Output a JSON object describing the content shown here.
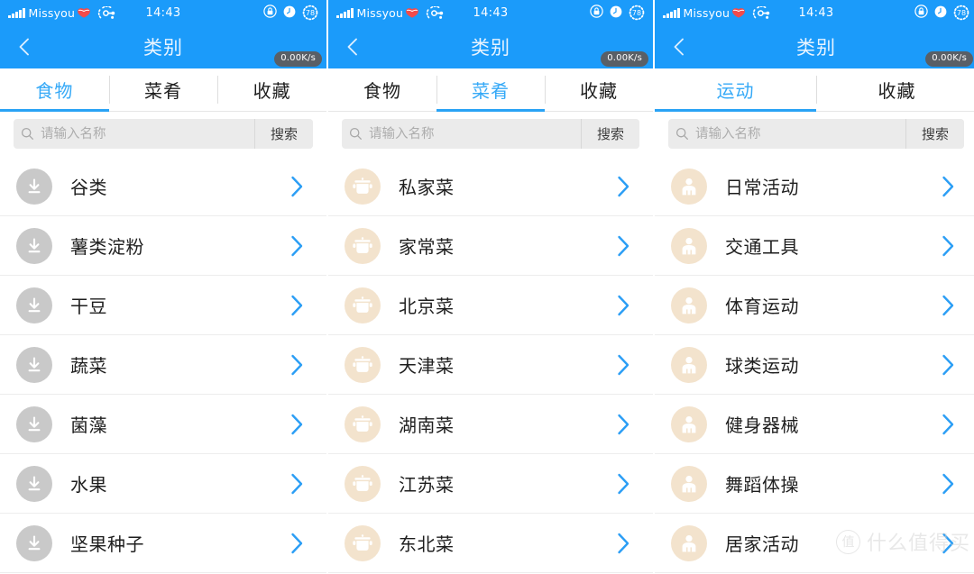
{
  "status_bar": {
    "carrier": "Missyou",
    "time": "14:43",
    "battery": "78",
    "icons": [
      "signal-bars-icon",
      "lips-icon",
      "network-ring-icon",
      "lock-icon",
      "alarm-icon",
      "battery-ring-icon"
    ]
  },
  "nav": {
    "title": "类别",
    "back_icon": "chevron-left-icon",
    "speed_badge": "0.00K/s"
  },
  "search": {
    "placeholder": "请输入名称",
    "value": "",
    "button_label": "搜索",
    "icon": "search-icon"
  },
  "colors": {
    "header_blue": "#1b9bfa",
    "tab_active_blue": "#35a9f7",
    "chevron_blue": "#2b9ef5",
    "icon_gray": "#c9c9c9",
    "icon_beige": "#f3e3cd",
    "search_bg": "#ebebeb",
    "badge_gray": "#595f66"
  },
  "watermark": {
    "mark": "值",
    "text": "什么值得买"
  },
  "panels": [
    {
      "id": "panel-food",
      "tabs": [
        {
          "label": "食物",
          "active": true
        },
        {
          "label": "菜肴",
          "active": false
        },
        {
          "label": "收藏",
          "active": false
        }
      ],
      "icon_style": "gray",
      "row_icon": "download-icon",
      "items": [
        {
          "label": "谷类"
        },
        {
          "label": "薯类淀粉"
        },
        {
          "label": "干豆"
        },
        {
          "label": "蔬菜"
        },
        {
          "label": "菌藻"
        },
        {
          "label": "水果"
        },
        {
          "label": "坚果种子"
        }
      ]
    },
    {
      "id": "panel-dishes",
      "tabs": [
        {
          "label": "食物",
          "active": false
        },
        {
          "label": "菜肴",
          "active": true
        },
        {
          "label": "收藏",
          "active": false
        }
      ],
      "icon_style": "beige",
      "row_icon": "cooking-pot-icon",
      "items": [
        {
          "label": "私家菜"
        },
        {
          "label": "家常菜"
        },
        {
          "label": "北京菜"
        },
        {
          "label": "天津菜"
        },
        {
          "label": "湖南菜"
        },
        {
          "label": "江苏菜"
        },
        {
          "label": "东北菜"
        }
      ]
    },
    {
      "id": "panel-exercise",
      "tabs": [
        {
          "label": "运动",
          "active": true
        },
        {
          "label": "收藏",
          "active": false
        }
      ],
      "icon_style": "beige",
      "row_icon": "person-icon",
      "items": [
        {
          "label": "日常活动"
        },
        {
          "label": "交通工具"
        },
        {
          "label": "体育运动"
        },
        {
          "label": "球类运动"
        },
        {
          "label": "健身器械"
        },
        {
          "label": "舞蹈体操"
        },
        {
          "label": "居家活动"
        }
      ]
    }
  ]
}
